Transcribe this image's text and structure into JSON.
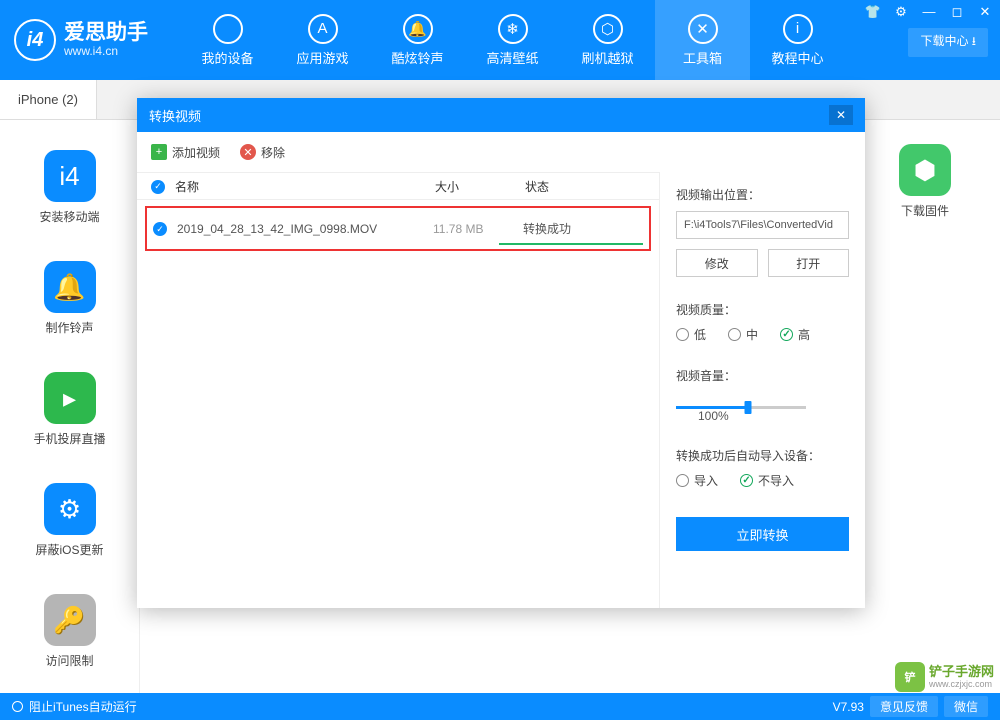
{
  "brand": {
    "name": "爱思助手",
    "url": "www.i4.cn",
    "logo_letter": "i4",
    "download_center": "下载中心"
  },
  "titlebar_icons": [
    "👕",
    "⚙",
    "—",
    "◻",
    "✕"
  ],
  "nav": [
    {
      "icon": "",
      "label": "我的设备"
    },
    {
      "icon": "A",
      "label": "应用游戏"
    },
    {
      "icon": "🔔",
      "label": "酷炫铃声"
    },
    {
      "icon": "❄",
      "label": "高清壁纸"
    },
    {
      "icon": "⬡",
      "label": "刷机越狱"
    },
    {
      "icon": "✕",
      "label": "工具箱",
      "active": true
    },
    {
      "icon": "i",
      "label": "教程中心"
    }
  ],
  "tab": "iPhone (2)",
  "sidebar": [
    {
      "color": "#0a8cff",
      "glyph": "i4",
      "label": "安装移动端"
    },
    {
      "color": "#0a8cff",
      "glyph": "🔔",
      "label": "制作铃声"
    },
    {
      "color": "#2db84d",
      "glyph": "▸",
      "label": "手机投屏直播"
    },
    {
      "color": "#0a8cff",
      "glyph": "⚙",
      "label": "屏蔽iOS更新"
    },
    {
      "color": "#b5b5b5",
      "glyph": "🔑",
      "label": "访问限制"
    }
  ],
  "right_card": {
    "glyph": "⬢",
    "label": "下载固件"
  },
  "dialog": {
    "title": "转换视频",
    "tool_add": "添加视频",
    "tool_remove": "移除",
    "cols": {
      "name": "名称",
      "size": "大小",
      "status": "状态"
    },
    "row": {
      "name": "2019_04_28_13_42_IMG_0998.MOV",
      "size": "11.78 MB",
      "status": "转换成功"
    },
    "output_label": "视频输出位置：",
    "output_path": "F:\\i4Tools7\\Files\\ConvertedVid",
    "btn_modify": "修改",
    "btn_open": "打开",
    "quality_label": "视频质量：",
    "quality_opts": [
      "低",
      "中",
      "高"
    ],
    "quality_sel": 2,
    "volume_label": "视频音量：",
    "volume_value": "100%",
    "import_label": "转换成功后自动导入设备：",
    "import_opts": [
      "导入",
      "不导入"
    ],
    "import_sel": 1,
    "primary": "立即转换"
  },
  "statusbar": {
    "itunes": "阻止iTunes自动运行",
    "version": "V7.93",
    "feedback": "意见反馈",
    "wechat": "微信"
  },
  "watermark": {
    "line1": "铲子手游网",
    "line2": "www.czjxjc.com"
  }
}
